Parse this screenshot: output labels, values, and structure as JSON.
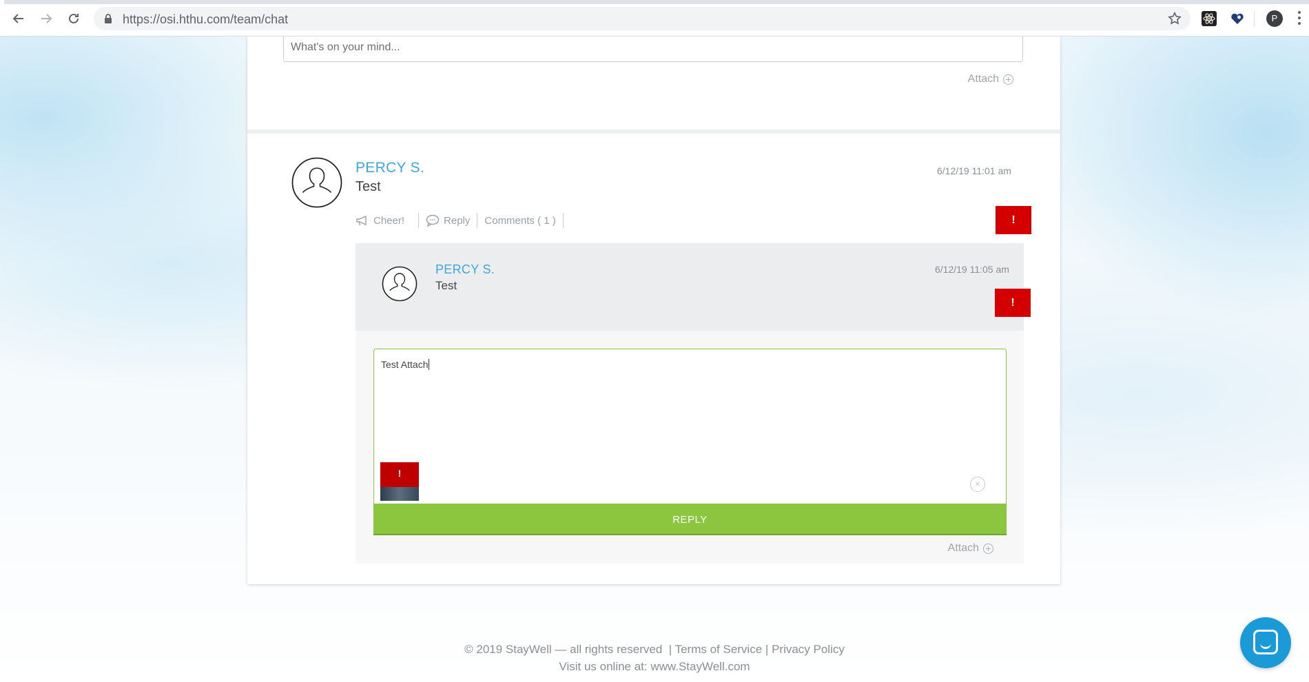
{
  "browser": {
    "url": "https://osi.hthu.com/team/chat",
    "profile_initial": "P"
  },
  "composer_top": {
    "placeholder": "What's on your mind...",
    "attach_label": "Attach"
  },
  "post": {
    "author": "PERCY S.",
    "text": "Test",
    "timestamp": "6/12/19 11:01 am",
    "actions": {
      "cheer": "Cheer!",
      "reply": "Reply",
      "comments": "Comments ( 1 )"
    },
    "flag_label": "!"
  },
  "reply": {
    "author": "PERCY S.",
    "text": "Test",
    "timestamp": "6/12/19 11:05 am",
    "flag_label": "!"
  },
  "reply_composer": {
    "text": "Test Attach",
    "thumbnail_flag": "!",
    "remove_label": "×",
    "submit_label": "REPLY",
    "attach_label": "Attach"
  },
  "footer": {
    "copyright": "©  2019  StayWell  —  all rights reserved",
    "terms": "Terms of Service",
    "privacy": "Privacy Policy",
    "visit": "Visit us online at: www.StayWell.com"
  },
  "colors": {
    "accent_blue": "#3fa7d9",
    "flag_red": "#d40000",
    "reply_green": "#8cc63f",
    "chat_blue": "#1a9bd7"
  }
}
